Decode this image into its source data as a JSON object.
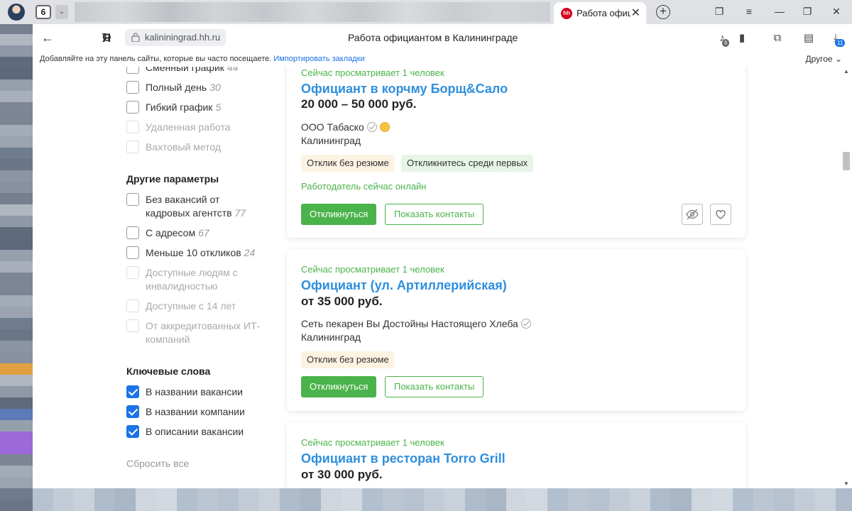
{
  "browser": {
    "tab_count": "6",
    "active_tab_title": "Работа официа",
    "hh_logo": "hh",
    "url": "kalininingrad.hh.ru",
    "page_title": "Работа официантом в Калининграде",
    "yandex_logo": "Я",
    "downloads_badge": "11",
    "extension_badge": "6"
  },
  "bookmarks_bar": {
    "text": "Добавляйте на эту панель сайты, которые вы часто посещаете.",
    "import_link": "Импортировать закладки",
    "other": "Другое"
  },
  "sidebar": {
    "schedule": [
      {
        "label": "Сменный график",
        "count": "44",
        "disabled": false
      },
      {
        "label": "Полный день",
        "count": "30",
        "disabled": false
      },
      {
        "label": "Гибкий график",
        "count": "5",
        "disabled": false
      },
      {
        "label": "Удаленная работа",
        "count": "",
        "disabled": true
      },
      {
        "label": "Вахтовый метод",
        "count": "",
        "disabled": true
      }
    ],
    "other_params_heading": "Другие параметры",
    "other_params": [
      {
        "label": "Без вакансий от кадровых агентств",
        "count": "77",
        "disabled": false
      },
      {
        "label": "С адресом",
        "count": "67",
        "disabled": false
      },
      {
        "label": "Меньше 10 откликов",
        "count": "24",
        "disabled": false
      },
      {
        "label": "Доступные людям с инвалидностью",
        "count": "",
        "disabled": true
      },
      {
        "label": "Доступные с 14 лет",
        "count": "",
        "disabled": true
      },
      {
        "label": "От аккредитованных ИТ-компаний",
        "count": "",
        "disabled": true
      }
    ],
    "keywords_heading": "Ключевые слова",
    "keywords": [
      {
        "label": "В названии вакансии",
        "checked": true
      },
      {
        "label": "В названии компании",
        "checked": true
      },
      {
        "label": "В описании вакансии",
        "checked": true
      }
    ],
    "reset": "Сбросить все"
  },
  "vacancies": [
    {
      "viewing": "Сейчас просматривает 1 человек",
      "title": "Официант в корчму Борщ&Сало",
      "salary": "20 000 – 50 000 руб.",
      "company": "ООО Табаско",
      "city": "Калининград",
      "tags": [
        "Отклик без резюме",
        "Откликнитесь среди первых"
      ],
      "online": "Работодатель сейчас онлайн",
      "apply": "Откликнуться",
      "contacts": "Показать контакты"
    },
    {
      "viewing": "Сейчас просматривает 1 человек",
      "title": "Официант (ул. Артиллерийская)",
      "salary": "от 35 000 руб.",
      "company": "Сеть пекарен Вы Достойны Настоящего Хлеба",
      "city": "Калининград",
      "tags": [
        "Отклик без резюме"
      ],
      "apply": "Откликнуться",
      "contacts": "Показать контакты"
    },
    {
      "viewing": "Сейчас просматривает 1 человек",
      "title": "Официант в ресторан Torro Grill",
      "salary": "от 30 000 руб."
    }
  ],
  "colors": {
    "accent_green": "#4bb34b",
    "title_blue": "#2f8fdc",
    "checkbox_blue": "#1a73e8",
    "hh_red": "#d6001c"
  }
}
